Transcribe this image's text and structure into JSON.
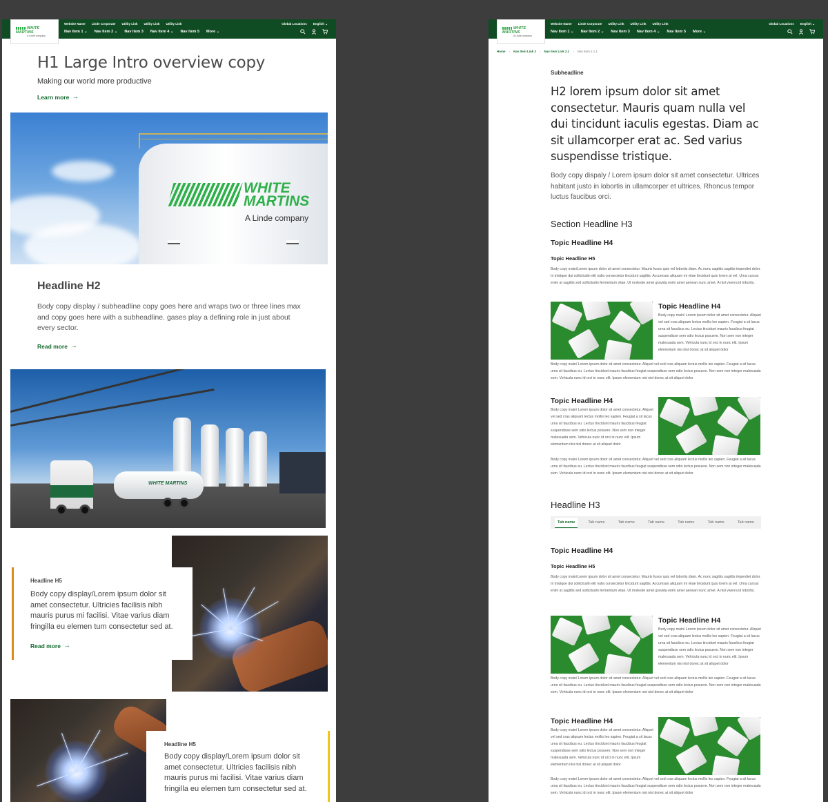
{
  "header": {
    "logo_text": "WHITE MARTINS",
    "logo_sub": "A Linde company",
    "utility": [
      "Website Name",
      "Linde Corporate",
      "Utility Link",
      "Utility Link",
      "Utility Link"
    ],
    "utility_right": [
      "Global Locations",
      "English ⌄"
    ],
    "nav": [
      "Nav Item 1 ⌄",
      "Nav Item 2 ⌄",
      "Nav Item 3",
      "Nav Item 4 ⌄",
      "Nav Item 5",
      "More ⌄"
    ],
    "icons": [
      "search-icon",
      "user-icon",
      "cart-icon"
    ]
  },
  "left": {
    "h1": "H1 Large Intro overview copy",
    "intro_sub": "Making our world more productive",
    "learn_more": "Learn more",
    "tank_logo_line1": "WHITE",
    "tank_logo_line2": "MARTINS",
    "tank_logo_sub": "A Linde company",
    "h2": "Headline H2",
    "body": "Body copy display / subheadline copy goes here and wraps two or three lines max and copy goes here with a subheadline. gases play a defining role in just about every sector.",
    "read_more": "Read more",
    "truck_logo": "WHITE MARTINS",
    "cards": [
      {
        "h5": "Headline H5",
        "body": "Body copy display/Lorem ipsum dolor sit amet consectetur. Ultricies facilisis nibh mauris purus mi facilisi. Vitae varius diam fringilla eu elemen tum consectetur sed at.",
        "link": "Read more",
        "accent": "#d98a1a"
      },
      {
        "h5": "Headline H5",
        "body": "Body copy display/Lorem ipsum dolor sit amet consectetur. Ultricies facilisis nibh mauris purus mi facilisi. Vitae varius diam fringilla eu elemen tum consectetur sed at.",
        "accent": "#f0c419"
      }
    ]
  },
  "right": {
    "breadcrumb": [
      "Home",
      "Nav Item Link 2",
      "Nav Item Link 2.1",
      "Nav Item 2.1.1"
    ],
    "subheadline": "Subheadline",
    "h2": "H2 lorem ipsum dolor sit amet consectetur. Mauris quam nulla vel dui tincidunt iaculis egestas. Diam ac sit ullamcorper erat ac. Sed varius suspendisse tristique.",
    "body": "Body copy dispaly / Lorem ipsum dolor sit amet consectetur. Ultrices habitant justo in lobortis in ullamcorper et ultrices. Rhoncus tempor luctus faucibus orci.",
    "section_h3": "Section Headline H3",
    "topic_h4": "Topic Headline H4",
    "topic_h5": "Topic Headline H5",
    "para": "Body copy main/Lorem ipsum dolor sit amet consectetur. Mauris fusce quis vel lobortis diam. Ac nunc sagittis sagittis imperdiet dolor. In tristique dui sollicitudin elit nulla consectetur tincidunt sagittis. Accumsan aliquam mi vitae tincidunt quis lorem at vel. Urna cursus enim at sagittis sed sollicitudin fermentum vitae. Ut molestie amet gravida enim amet aenean nunc amet. A nisl viverra id lobortis.",
    "media_short": "Body copy main/ Lorem ipsum dolor sit amet consectetur. Aliquet vel sed cras aliquam lectus mollis leo sapien. Feugiat a sit lacus urna sit faucibus eu. Lectus tincidunt mauris faucibus feugiat suspendisse sem odio lectus posuere. Non sem non integer malesuada sem. Vehicula nunc id orci in nunc elit. Ipsum elementum nisi nisl donec at sit aliquet dolor",
    "media_long": "Body copy main/ Lorem ipsum dolor sit amet consectetur. Aliquet vel sed cras aliquam lectus mollis leo sapien. Feugiat a sit lacus urna sit faucibus eu. Lectus tincidunt mauris faucibus feugiat suspendisse sem odio lectus posuere. Non sem non integer malesuada sem. Vehicula nunc id orci in nunc elit. Ipsum elementum nisi nisl donec at sit aliquet dolor",
    "headline_h3": "Headline H3",
    "tabs": [
      "Tab name",
      "Tab name",
      "Tab name",
      "Tab name",
      "Tab name",
      "Tab name",
      "Tab name"
    ]
  }
}
